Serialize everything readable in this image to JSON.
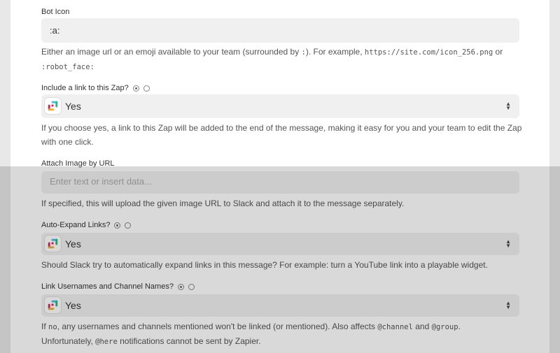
{
  "bot_icon": {
    "label": "Bot Icon",
    "value": ":a:",
    "help_before": "Either an image url or an emoji available to your team (surrounded by ",
    "help_colon": ":",
    "help_mid": "). For example, ",
    "help_example_url": "https://site.com/icon_256.png",
    "help_or": " or",
    "help_example_emoji": ":robot_face:"
  },
  "include_link": {
    "label": "Include a link to this Zap?",
    "value": "Yes",
    "help": "If you choose yes, a link to this Zap will be added to the end of the message, making it easy for you and your team to edit the Zap with one click."
  },
  "attach_image": {
    "label": "Attach Image by URL",
    "placeholder": "Enter text or insert data...",
    "help": "If specified, this will upload the given image URL to Slack and attach it to the message separately."
  },
  "auto_expand": {
    "label": "Auto-Expand Links?",
    "value": "Yes",
    "help": "Should Slack try to automatically expand links in this message? For example: turn a YouTube link into a playable widget."
  },
  "link_names": {
    "label": "Link Usernames and Channel Names?",
    "value": "Yes",
    "help_1": "If ",
    "help_no": "no",
    "help_2": ", any usernames and channels mentioned won't be linked (or mentioned). Also affects ",
    "help_channel": "@channel",
    "help_and": " and ",
    "help_group": "@group",
    "help_3": ".",
    "help_4": "Unfortunately, ",
    "help_here": "@here",
    "help_5": " notifications cannot be sent by Zapier."
  },
  "icons": {
    "select": "slack-icon",
    "arrows": "updown-arrows-icon"
  }
}
